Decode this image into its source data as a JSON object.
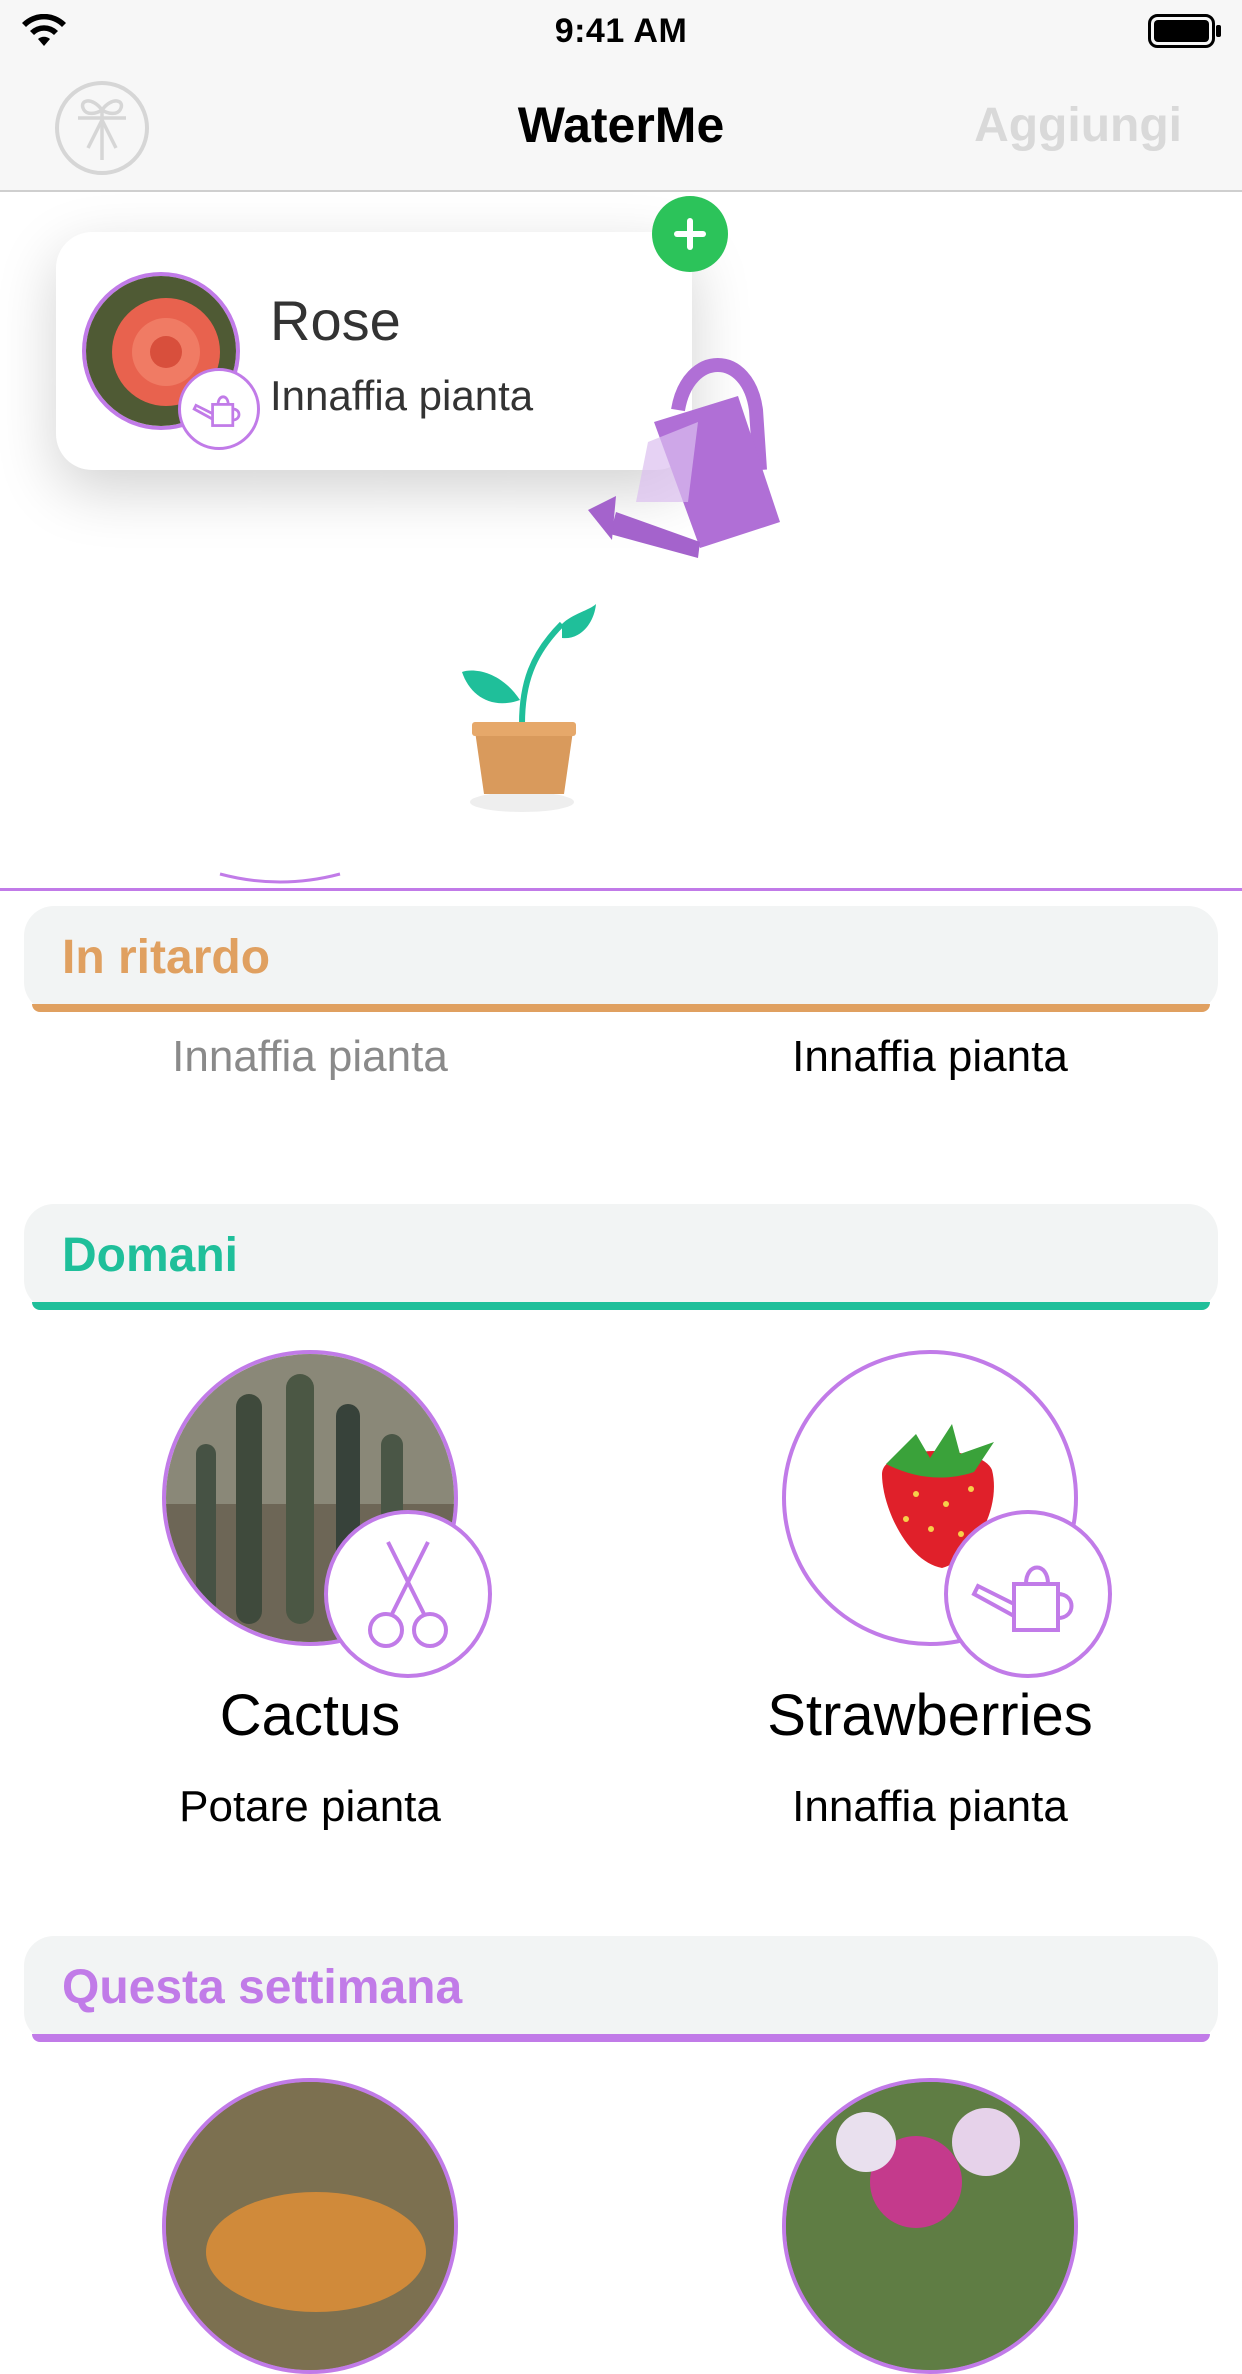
{
  "status": {
    "time": "9:41 AM"
  },
  "nav": {
    "title": "WaterMe",
    "action": "Aggiungi",
    "left_icon": "gift-icon"
  },
  "drag_card": {
    "name": "Rose",
    "task": "Innaffia pianta"
  },
  "sections": {
    "late": {
      "title": "In ritardo",
      "color": "#e0a060",
      "items": [
        {
          "task": "Innaffia pianta"
        },
        {
          "task": "Innaffia pianta"
        }
      ]
    },
    "tomorrow": {
      "title": "Domani",
      "color": "#1fbf9a",
      "items": [
        {
          "name": "Cactus",
          "task": "Potare pianta",
          "icon": "scissors-icon"
        },
        {
          "name": "Strawberries",
          "task": "Innaffia pianta",
          "icon": "watering-can-icon"
        }
      ]
    },
    "week": {
      "title": "Questa settimana",
      "color": "#c17be8"
    }
  },
  "colors": {
    "accent": "#c17be8",
    "add": "#2cc35a"
  }
}
